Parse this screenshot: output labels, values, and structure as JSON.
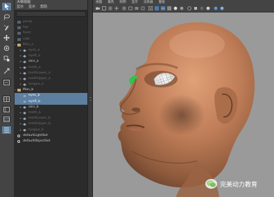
{
  "outliner": {
    "title": "大纲视图",
    "menus": [
      "显示",
      "显示",
      "帮助"
    ],
    "rows": [
      {
        "label": "persp",
        "dim": true,
        "indent": 0,
        "icon": "camera"
      },
      {
        "label": "top",
        "dim": true,
        "indent": 0,
        "icon": "camera"
      },
      {
        "label": "front",
        "dim": true,
        "indent": 0,
        "icon": "camera"
      },
      {
        "label": "side",
        "dim": true,
        "indent": 0,
        "icon": "camera"
      },
      {
        "label": "Man_a",
        "dim": true,
        "indent": 0,
        "icon": "group",
        "exp": "−"
      },
      {
        "label": "eyeL_a",
        "dim": true,
        "indent": 1,
        "icon": "mesh",
        "exp": "+"
      },
      {
        "label": "eyeR_a",
        "dim": true,
        "indent": 1,
        "icon": "mesh",
        "exp": "+"
      },
      {
        "label": "skin_a",
        "dim": false,
        "indent": 1,
        "icon": "mesh",
        "exp": "+"
      },
      {
        "label": "teeth_a",
        "dim": true,
        "indent": 1,
        "icon": "mesh",
        "exp": "+"
      },
      {
        "label": "teethLower_a",
        "dim": true,
        "indent": 1,
        "icon": "mesh",
        "exp": "+"
      },
      {
        "label": "teethUpper_a",
        "dim": true,
        "indent": 1,
        "icon": "mesh",
        "exp": "+"
      },
      {
        "label": "tongue_a",
        "dim": true,
        "indent": 1,
        "icon": "mesh",
        "exp": "+"
      },
      {
        "label": "Man_b",
        "dim": false,
        "indent": 0,
        "icon": "group",
        "exp": "−"
      },
      {
        "label": "eyeL_b",
        "dim": false,
        "indent": 1,
        "icon": "mesh",
        "exp": "+",
        "sel": true
      },
      {
        "label": "eyeR_b",
        "dim": false,
        "indent": 1,
        "icon": "mesh",
        "exp": "+",
        "sel": true
      },
      {
        "label": "skin_b",
        "dim": false,
        "indent": 1,
        "icon": "mesh",
        "exp": "+"
      },
      {
        "label": "teeth_b",
        "dim": true,
        "indent": 1,
        "icon": "mesh",
        "exp": "+"
      },
      {
        "label": "teethLower_b",
        "dim": true,
        "indent": 1,
        "icon": "mesh",
        "exp": "+"
      },
      {
        "label": "teethUpper_b",
        "dim": true,
        "indent": 1,
        "icon": "mesh",
        "exp": "+"
      },
      {
        "label": "tongue_b",
        "dim": true,
        "indent": 1,
        "icon": "mesh",
        "exp": "+"
      },
      {
        "label": "defaultLightSet",
        "dim": false,
        "indent": 0,
        "icon": "set"
      },
      {
        "label": "defaultObjectSet",
        "dim": false,
        "indent": 0,
        "icon": "set"
      }
    ]
  },
  "viewport": {
    "menus": [
      "视图",
      "着色",
      "照明",
      "显示",
      "渲染器",
      "面板"
    ]
  },
  "watermark": {
    "text": "完美动力教育"
  },
  "colors": {
    "selection": "#5d7fa0",
    "viewport_bg": "#9a9a9a",
    "outliner_bg": "#2b2b2b",
    "eye_green": "#2ec44a"
  },
  "tools": [
    "select-arrow-icon",
    "lasso-icon",
    "paint-select-icon",
    "move-icon",
    "rotate-icon",
    "scale-icon",
    "last-tool-icon",
    "layout-single-icon",
    "layout-four-icon",
    "layout-side-icon",
    "outliner-layout-icon"
  ]
}
